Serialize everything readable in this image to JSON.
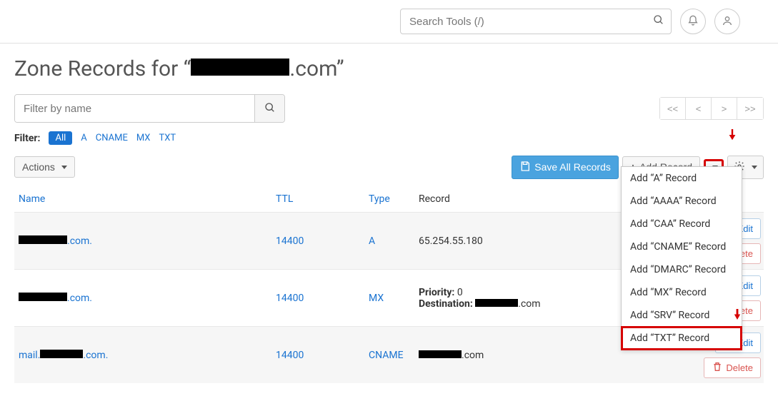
{
  "search": {
    "placeholder": "Search Tools (/)"
  },
  "title_prefix": "Zone Records for “",
  "title_suffix": ".com”",
  "filter": {
    "placeholder": "Filter by name",
    "label": "Filter:"
  },
  "record_types": [
    "All",
    "A",
    "CNAME",
    "MX",
    "TXT"
  ],
  "pager": {
    "first": "<<",
    "prev": "<",
    "next": ">",
    "last": ">>"
  },
  "buttons": {
    "actions": "Actions",
    "save_all": "Save All Records",
    "add_record": "Add Record",
    "edit": "Edit",
    "delete": "Delete"
  },
  "columns": {
    "name": "Name",
    "ttl": "TTL",
    "type": "Type",
    "record": "Record"
  },
  "rows": [
    {
      "name_suffix": ".com.",
      "ttl": "14400",
      "type": "A",
      "record": "65.254.55.180"
    },
    {
      "name_suffix": ".com.",
      "ttl": "14400",
      "type": "MX",
      "priority_label": "Priority:",
      "priority": "0",
      "dest_label": "Destination:",
      "dest_suffix": ".com"
    },
    {
      "name_prefix": "mail.",
      "name_suffix": ".com.",
      "ttl": "14400",
      "type": "CNAME",
      "record_suffix": ".com"
    }
  ],
  "dropdown": [
    "Add “A” Record",
    "Add “AAAA” Record",
    "Add “CAA” Record",
    "Add “CNAME” Record",
    "Add “DMARC” Record",
    "Add “MX” Record",
    "Add “SRV” Record",
    "Add “TXT” Record"
  ]
}
